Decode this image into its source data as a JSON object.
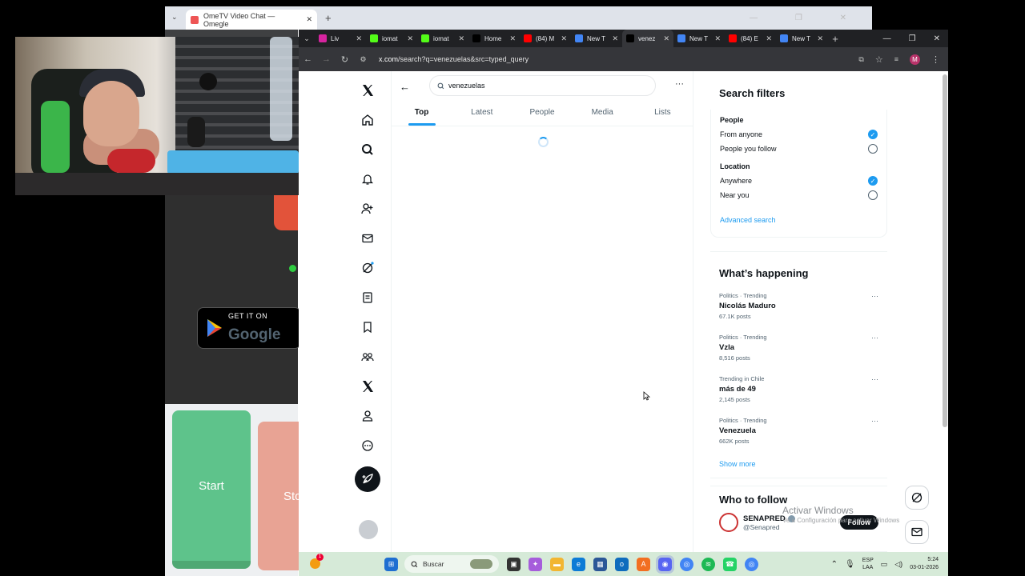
{
  "background_window": {
    "tab_title": "OmeTV Video Chat — Omegle",
    "store_badge_small": "GET IT ON",
    "store_badge_big": "Google",
    "start_label": "Start",
    "stop_label": "Sto"
  },
  "browser": {
    "tabs": [
      {
        "label": "Liv",
        "icon": "instagram-icon",
        "color": "#d6249f"
      },
      {
        "label": "iomat",
        "icon": "kick-icon",
        "color": "#53fc18"
      },
      {
        "label": "iomat",
        "icon": "kick-icon",
        "color": "#53fc18"
      },
      {
        "label": "Home",
        "icon": "x-icon",
        "color": "#000000"
      },
      {
        "label": "(84) M",
        "icon": "youtube-icon",
        "color": "#ff0000"
      },
      {
        "label": "New T",
        "icon": "chrome-icon",
        "color": "#4285f4"
      },
      {
        "label": "venez",
        "icon": "x-icon",
        "color": "#000000",
        "active": true
      },
      {
        "label": "New T",
        "icon": "chrome-icon",
        "color": "#4285f4"
      },
      {
        "label": "(84) E",
        "icon": "youtube-icon",
        "color": "#ff0000"
      },
      {
        "label": "New T",
        "icon": "chrome-icon",
        "color": "#4285f4"
      }
    ],
    "url_host": "x.com",
    "url_path": "/search?q=venezuelas&src=typed_query",
    "profile_initial": "M"
  },
  "x": {
    "search_value": "venezuelas",
    "tabs": [
      "Top",
      "Latest",
      "People",
      "Media",
      "Lists"
    ],
    "active_tab": "Top",
    "filters": {
      "title": "Search filters",
      "people_heading": "People",
      "from_anyone": "From anyone",
      "people_you_follow": "People you follow",
      "location_heading": "Location",
      "anywhere": "Anywhere",
      "near_you": "Near you",
      "advanced": "Advanced search"
    },
    "happening": {
      "title": "What’s happening",
      "trends": [
        {
          "meta": "Politics · Trending",
          "name": "Nicolás Maduro",
          "count": "67.1K posts"
        },
        {
          "meta": "Politics · Trending",
          "name": "Vzla",
          "count": "8,516 posts"
        },
        {
          "meta": "Trending in Chile",
          "name": "más de 49",
          "count": "2,145 posts"
        },
        {
          "meta": "Politics · Trending",
          "name": "Venezuela",
          "count": "662K posts"
        }
      ],
      "show_more": "Show more"
    },
    "who_to_follow": {
      "title": "Who to follow",
      "name": "SENAPRED",
      "handle": "@Senapred",
      "follow": "Follow"
    }
  },
  "overlay": {
    "activate_title": "Activar Windows",
    "activate_sub": "Ve a Configuración para activar Windows"
  },
  "taskbar": {
    "search_placeholder": "Buscar",
    "lang_top": "ESP",
    "lang_bottom": "LAA",
    "time": "5:24",
    "date": "03-01-2026",
    "notification_count": "1"
  }
}
